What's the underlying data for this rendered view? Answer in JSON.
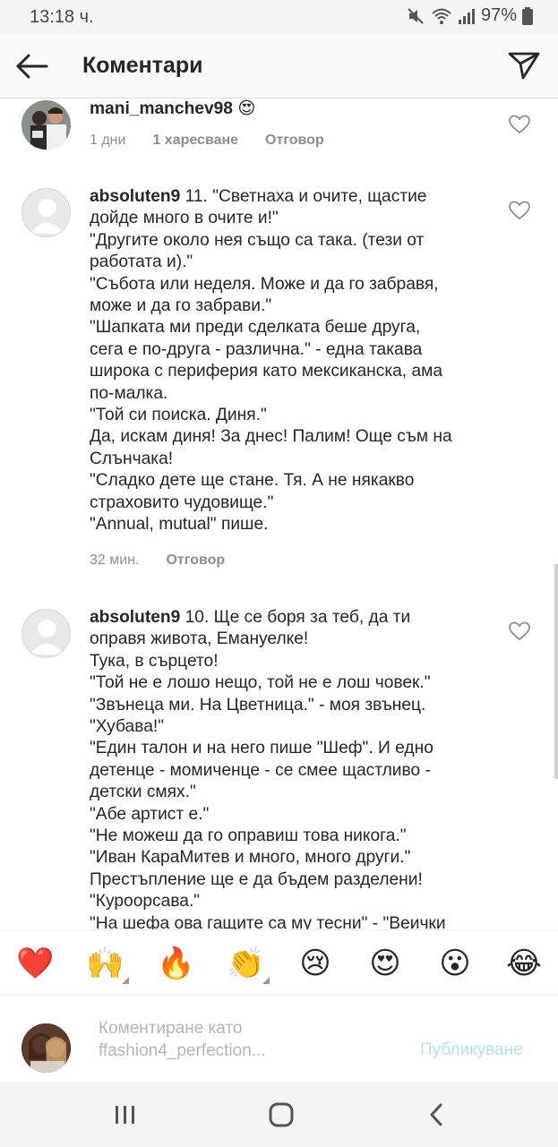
{
  "status": {
    "time": "13:18 ч.",
    "battery": "97%",
    "icons": [
      "mute-icon",
      "wifi-icon",
      "signal-icon",
      "battery-icon"
    ]
  },
  "header": {
    "title": "Коментари",
    "back_icon": "arrow-left-icon",
    "send_icon": "paper-plane-icon"
  },
  "comments": [
    {
      "user": "mani_manchev98",
      "lines": [
        " 😍"
      ],
      "time": "1 дни",
      "likes": "1 харесване",
      "reply": "Отговор"
    },
    {
      "user": "absoluten9",
      "lines": [
        " 11. \"Светнаха и очите, щастие",
        "дойде много в очите и!\"",
        "\"Другите около нея също са така. (тези от",
        "работата и).\"",
        "\"Събота или неделя. Може и да го забравя,",
        "може и да го забрави.\"",
        "\"Шапката ми преди сделката беше друга,",
        "сега е по-друга - различна.\" - една такава",
        "широка с периферия като мексиканска, ама",
        "по-малка.",
        "\"Той си поиска. Диня.\"",
        "Да, искам диня! За днес! Палим! Още съм на",
        "Слънчака!",
        "\"Сладко дете ще стане. Тя. А не някакво",
        "страховито чудовище.\"",
        "\"Annual, mutual\" пише."
      ],
      "time": "32 мин.",
      "reply": "Отговор"
    },
    {
      "user": "absoluten9",
      "lines": [
        " 10. Ще се боря за теб, да ти",
        "оправя живота, Емануелке!",
        "Тука, в сърцето!",
        "\"Той не е лошо нещо, той не е лош човек.\"",
        "\"Звънеца ми. На Цветница.\" - моя звънец.",
        "\"Хубава!\"",
        "\"Един талон и на него пише \"Шеф\". И едно",
        "детенце - момиченце - се смее щастливо -",
        "детски смях.\"",
        "\"Абе артист е.\"",
        "\"Не можеш да го оправиш това никога.\"",
        "\"Иван КараМитев и много, много други.\"",
        "Престъпление ще е да бъдем разделени!",
        "\"Куроорсава.\"",
        "\"На шефа ова гащите са му тесни\" - \"Веички"
      ]
    }
  ],
  "emoji_bar": [
    {
      "glyph": "❤️",
      "name": "red-heart-emoji"
    },
    {
      "glyph": "🙌",
      "name": "raising-hands-emoji"
    },
    {
      "glyph": "🔥",
      "name": "fire-emoji"
    },
    {
      "glyph": "👏",
      "name": "clapping-hands-emoji"
    },
    {
      "glyph": "😢",
      "name": "crying-face-emoji"
    },
    {
      "glyph": "😍",
      "name": "heart-eyes-emoji"
    },
    {
      "glyph": "😮",
      "name": "surprised-face-emoji"
    },
    {
      "glyph": "😂",
      "name": "tears-of-joy-emoji"
    }
  ],
  "compose": {
    "placeholder_line1": "Коментиране като",
    "placeholder_line2": "ffashion4_perfection...",
    "publish_label": "Публикуване"
  },
  "colors": {
    "text": "#262626",
    "muted": "#8e8e8e",
    "publish_disabled": "#b2dffc",
    "header_bg": "#fafafa"
  }
}
